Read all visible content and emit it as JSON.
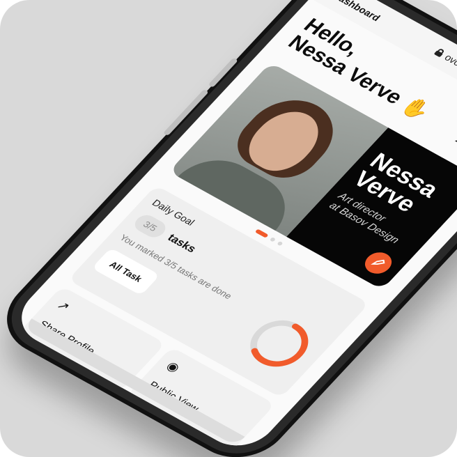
{
  "header": {
    "title": "Dashboard",
    "url": "ovou.me"
  },
  "greeting": {
    "line1": "Hello,",
    "line2": "Nessa Verve",
    "emoji": "✋"
  },
  "profile_card": {
    "name_line1": "Nessa",
    "name_line2": "Verve",
    "role_line1": "Art director",
    "role_line2": "at Basov Design"
  },
  "goal": {
    "title": "Daily Goal",
    "count": "3/5",
    "unit": "tasks",
    "description": "You marked 3/5 tasks are done",
    "button": "All Task",
    "progress_fraction": 0.6
  },
  "actions": {
    "share": "Share Profile",
    "public": "Public View"
  },
  "colors": {
    "accent": "#f15b2b",
    "card_dark": "#060606",
    "screen_bg": "#fafafa"
  }
}
